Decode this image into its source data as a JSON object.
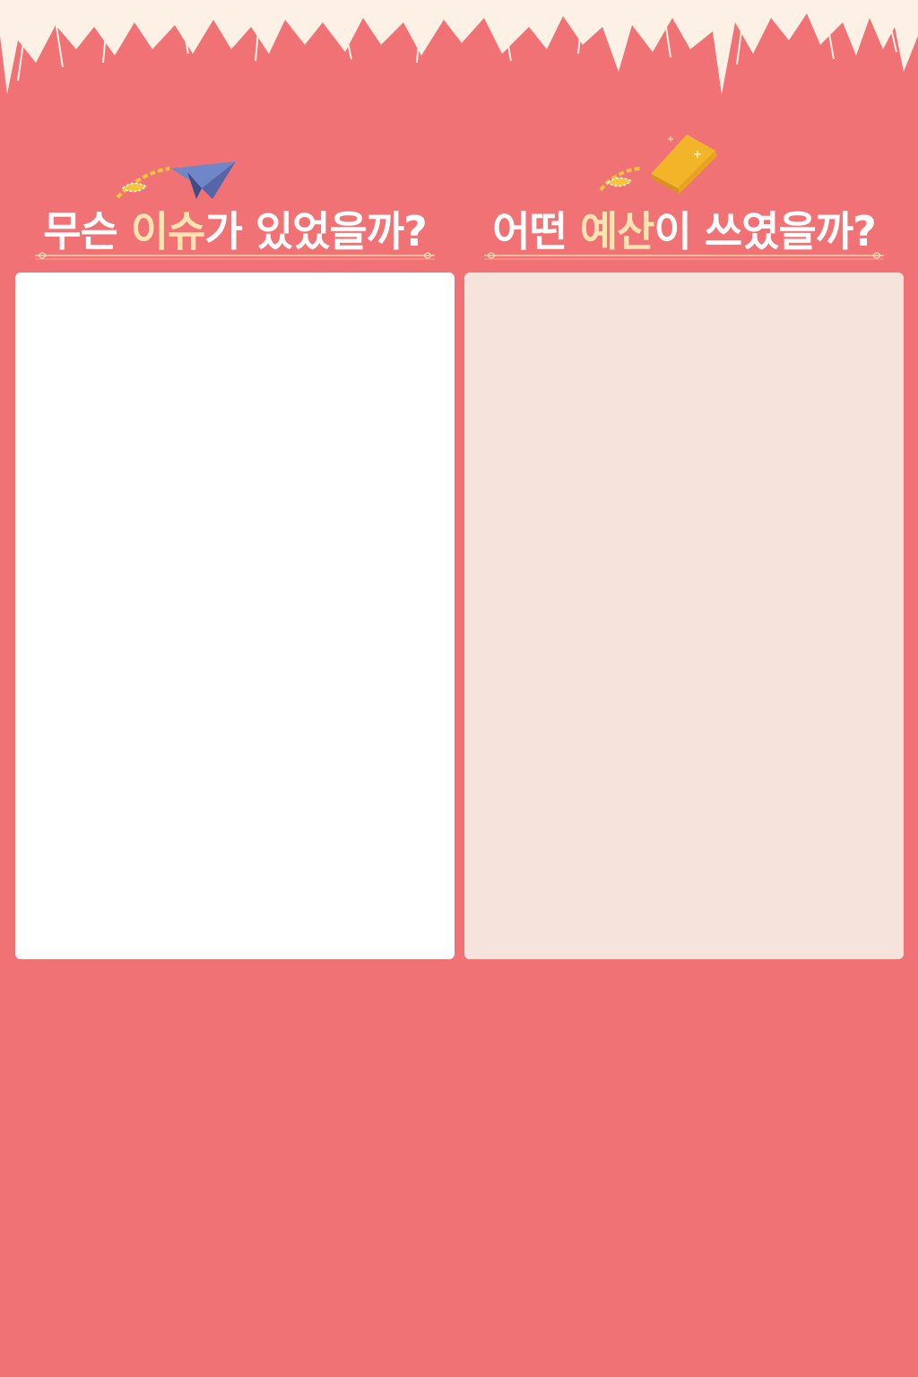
{
  "colors": {
    "background": "#f07275",
    "highlight": "#fde3b0",
    "fringe": "#fdf1e6",
    "panel_left": "#ffffff",
    "panel_right": "#f6e4dc"
  },
  "left": {
    "title_pre": "무슨 ",
    "title_hl": "이슈",
    "title_post": "가 있었을까?",
    "icon": "paper-plane-icon"
  },
  "right": {
    "title_pre": "어떤 ",
    "title_hl": "예산",
    "title_post": "이 쓰였을까?",
    "icon": "gold-bar-icon"
  }
}
